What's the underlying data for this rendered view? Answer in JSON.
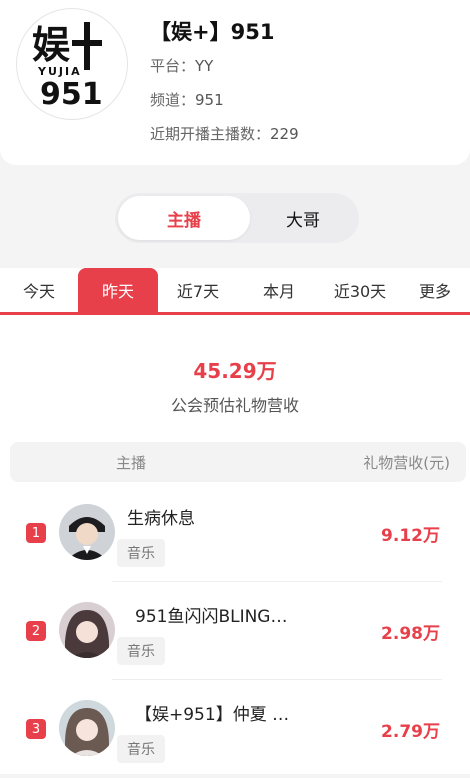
{
  "header": {
    "logo_text": "娱+ YUJIA 951",
    "title": "【娱+】951",
    "platform_label": "平台：",
    "platform_value": "YY",
    "channel_label": "频道：",
    "channel_value": "951",
    "anchors_label": "近期开播主播数：",
    "anchors_value": "229"
  },
  "toggle": {
    "options": [
      "主播",
      "大哥"
    ],
    "selected": "主播"
  },
  "tabs": {
    "items": [
      "今天",
      "昨天",
      "近7天",
      "本月",
      "近30天",
      "更多"
    ],
    "selected": "昨天"
  },
  "summary": {
    "value": "45.29万",
    "label": "公会预估礼物营收"
  },
  "table": {
    "col_host": "主播",
    "col_revenue": "礼物营收(元)",
    "rows": [
      {
        "rank": "1",
        "name": "生病休息",
        "tag": "音乐",
        "revenue": "9.12万"
      },
      {
        "rank": "2",
        "name": "951鱼闪闪BLING…",
        "tag": "音乐",
        "revenue": "2.98万"
      },
      {
        "rank": "3",
        "name": "【娱+951】仲夏 …",
        "tag": "音乐",
        "revenue": "2.79万"
      }
    ]
  },
  "colors": {
    "accent": "#e8404b",
    "background": "#f4f4f5"
  }
}
